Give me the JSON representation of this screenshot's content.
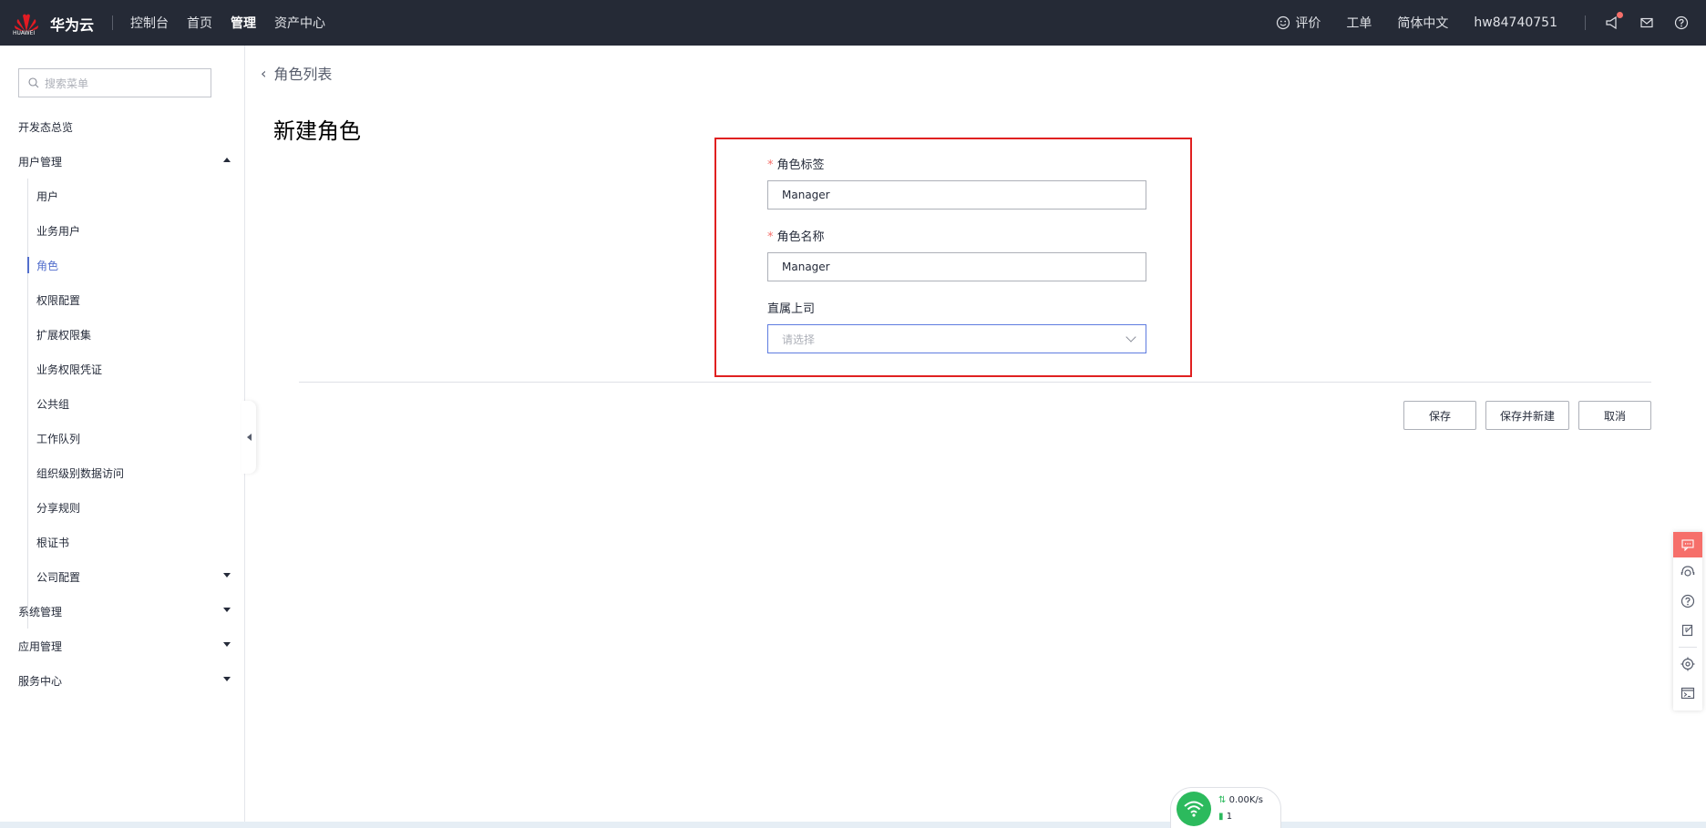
{
  "topbar": {
    "logo_text": "HUAWEI",
    "brand": "华为云",
    "nav": [
      "控制台",
      "首页",
      "管理",
      "资产中心"
    ],
    "active_nav": "管理",
    "feedback": "评价",
    "ticket": "工单",
    "language": "简体中文",
    "user": "hw84740751"
  },
  "sidebar": {
    "search_placeholder": "搜索菜单",
    "items": [
      {
        "label": "开发态总览",
        "level": 1
      },
      {
        "label": "用户管理",
        "level": 1,
        "expanded": true
      },
      {
        "label": "用户",
        "level": 2
      },
      {
        "label": "业务用户",
        "level": 2
      },
      {
        "label": "角色",
        "level": 2,
        "active": true
      },
      {
        "label": "权限配置",
        "level": 2
      },
      {
        "label": "扩展权限集",
        "level": 2
      },
      {
        "label": "业务权限凭证",
        "level": 2
      },
      {
        "label": "公共组",
        "level": 2
      },
      {
        "label": "工作队列",
        "level": 2
      },
      {
        "label": "组织级别数据访问",
        "level": 2
      },
      {
        "label": "分享规则",
        "level": 2
      },
      {
        "label": "根证书",
        "level": 2
      },
      {
        "label": "公司配置",
        "level": 2,
        "collapsed": true
      },
      {
        "label": "系统管理",
        "level": 1,
        "collapsed": true
      },
      {
        "label": "应用管理",
        "level": 1,
        "collapsed": true
      },
      {
        "label": "服务中心",
        "level": 1,
        "collapsed": true
      }
    ]
  },
  "main": {
    "breadcrumb": "角色列表",
    "title": "新建角色",
    "form": {
      "role_label": {
        "label": "角色标签",
        "required": true,
        "value": "Manager"
      },
      "role_name": {
        "label": "角色名称",
        "required": true,
        "value": "Manager"
      },
      "manager": {
        "label": "直属上司",
        "placeholder": "请选择"
      }
    },
    "buttons": {
      "save": "保存",
      "save_new": "保存并新建",
      "cancel": "取消"
    }
  },
  "network": {
    "speed": "0.00K/s",
    "count": "1"
  },
  "colors": {
    "topbar": "#252a36",
    "accent": "#526ecc",
    "highlight_box": "#e02020",
    "required": "#f66f6a"
  }
}
